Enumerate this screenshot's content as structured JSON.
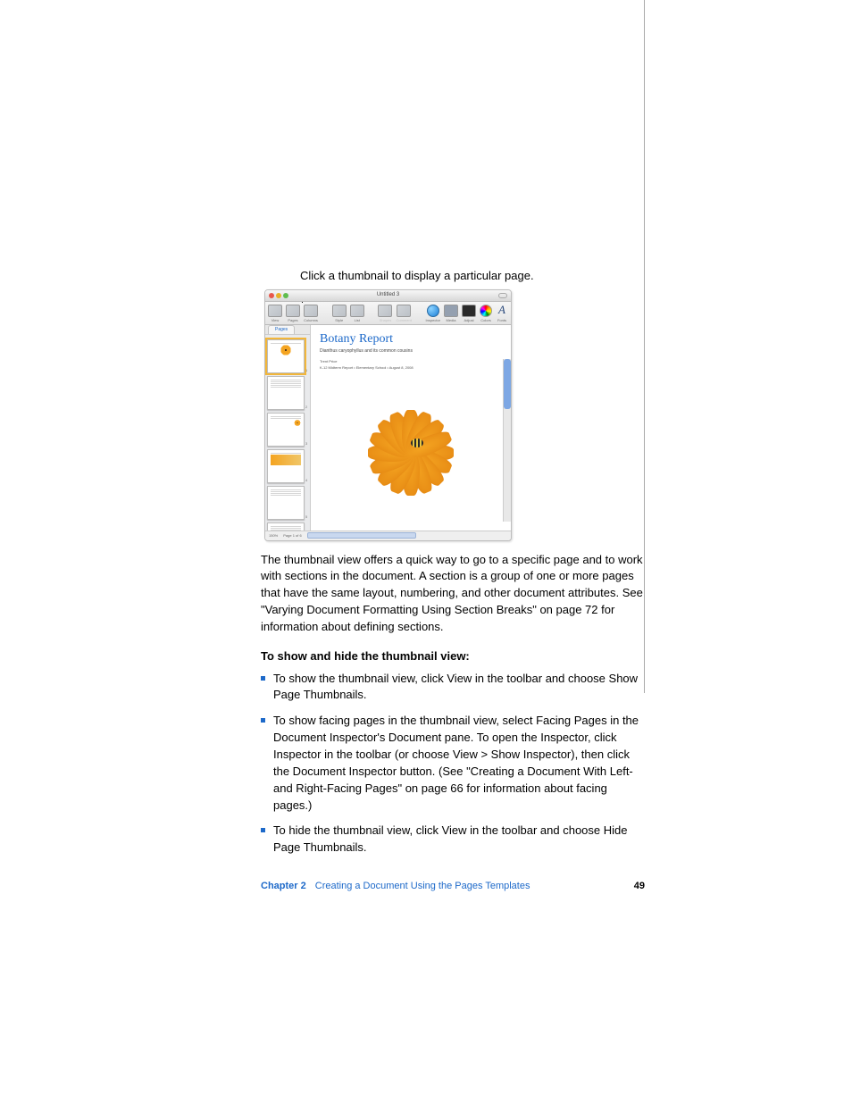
{
  "callout": "Click a thumbnail to display a particular page.",
  "screenshot": {
    "window_title": "Untitled 3",
    "toolbar": [
      {
        "id": "view",
        "label": "View"
      },
      {
        "id": "pages",
        "label": "Pages"
      },
      {
        "id": "columns",
        "label": "Columns"
      },
      {
        "id": "style",
        "label": "Style"
      },
      {
        "id": "list",
        "label": "List"
      },
      {
        "id": "shapes",
        "label": "Shapes"
      },
      {
        "id": "comment",
        "label": "Comment"
      },
      {
        "id": "inspector",
        "label": "Inspector"
      },
      {
        "id": "media",
        "label": "Media"
      },
      {
        "id": "adjust",
        "label": "Adjust"
      },
      {
        "id": "colors",
        "label": "Colors"
      },
      {
        "id": "fonts",
        "label": "Fonts"
      }
    ],
    "sidebar_tab": "Pages",
    "thumbnails": [
      1,
      2,
      3,
      4,
      5,
      6
    ],
    "selected_thumbnail": 1,
    "document": {
      "title": "Botany Report",
      "subtitle": "Dianthus caryophyllus and its common cousins",
      "author": "Trent Price",
      "context": "K-12 Midterm Report • Elementary School • August 8, 2008"
    },
    "status": {
      "zoom": "150%",
      "pages": "Page 1 of 6"
    }
  },
  "body": {
    "p1": "The thumbnail view offers a quick way to go to a specific page and to work with sections in the document. A section is a group of one or more pages that have the same layout, numbering, and other document attributes. See \"Varying Document Formatting Using Section Breaks\" on page 72 for information about defining sections.",
    "h1": "To show and hide the thumbnail view:",
    "b1": "To show the thumbnail view, click View in the toolbar and choose Show Page Thumbnails.",
    "b2": "To show facing pages in the thumbnail view, select Facing Pages in the Document Inspector's Document pane. To open the Inspector, click Inspector in the toolbar (or choose View > Show Inspector), then click the Document Inspector button. (See \"Creating a Document With Left- and Right-Facing Pages\" on page 66 for information about facing pages.)",
    "b3": "To hide the thumbnail view, click View in the toolbar and choose Hide Page Thumbnails."
  },
  "footer": {
    "chapter": "Chapter 2",
    "title": "Creating a Document Using the Pages Templates",
    "page": "49"
  }
}
